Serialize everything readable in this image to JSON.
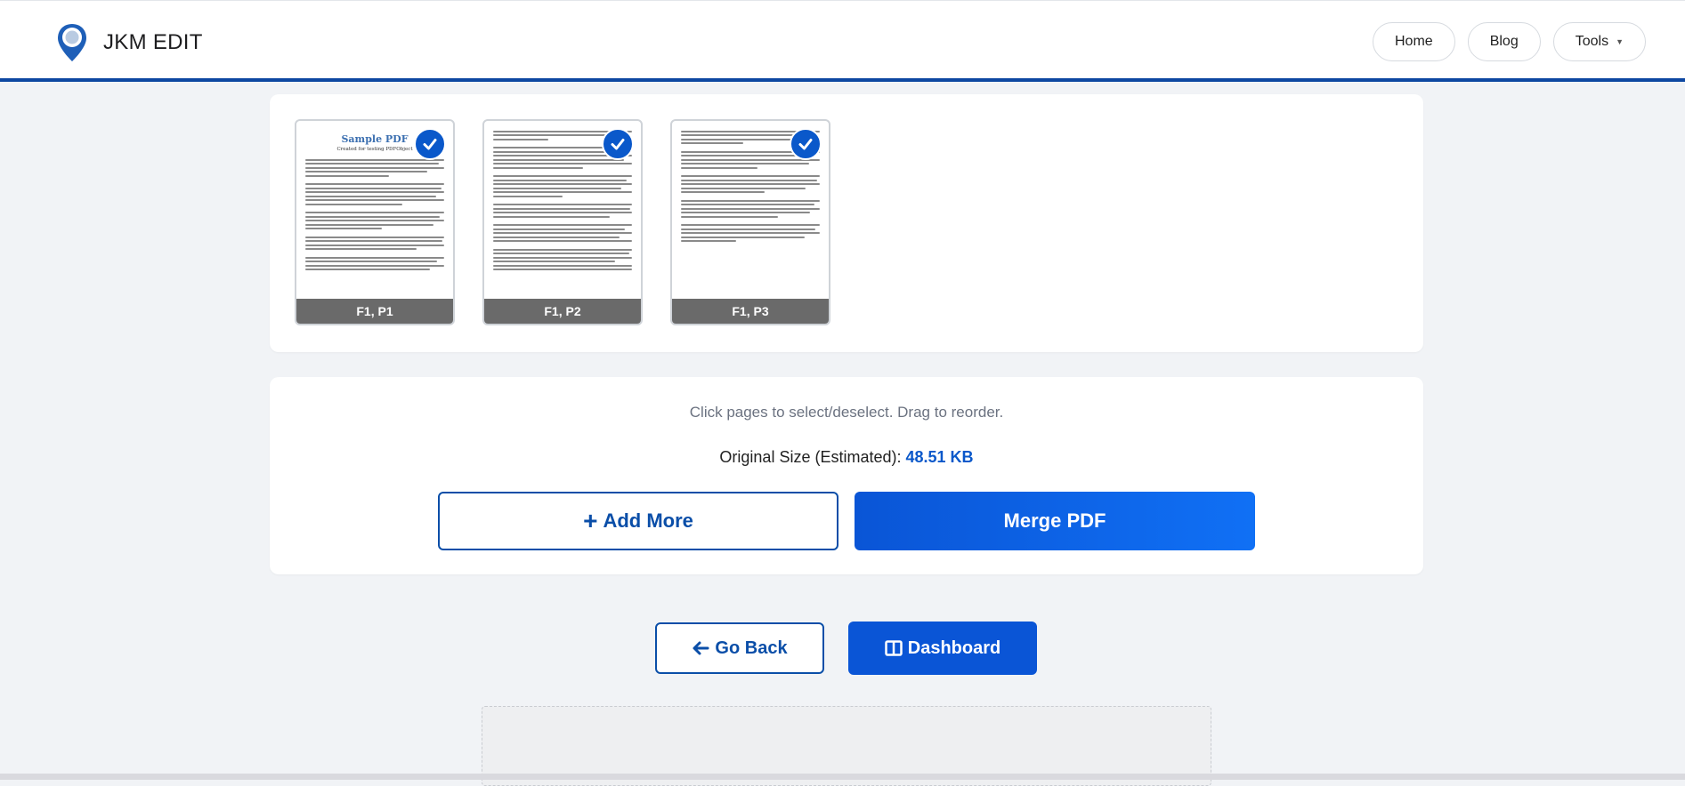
{
  "header": {
    "brand": "JKM EDIT",
    "nav": [
      {
        "label": "Home"
      },
      {
        "label": "Blog"
      },
      {
        "label": "Tools"
      }
    ]
  },
  "pages": [
    {
      "label": "F1, P1",
      "selected": true,
      "doc_title": "Sample PDF",
      "doc_subtitle": "Created for testing PDFObject"
    },
    {
      "label": "F1, P2",
      "selected": true
    },
    {
      "label": "F1, P3",
      "selected": true
    }
  ],
  "info": {
    "hint": "Click pages to select/deselect. Drag to reorder.",
    "size_label": "Original Size (Estimated):",
    "size_value": "48.51 KB",
    "add_more_label": "Add More",
    "merge_label": "Merge PDF"
  },
  "actions": {
    "back_label": "Go Back",
    "dashboard_label": "Dashboard"
  },
  "colors": {
    "accent": "#0a55d6",
    "header_border": "#0d47a1",
    "size_value": "#0a58ca"
  }
}
